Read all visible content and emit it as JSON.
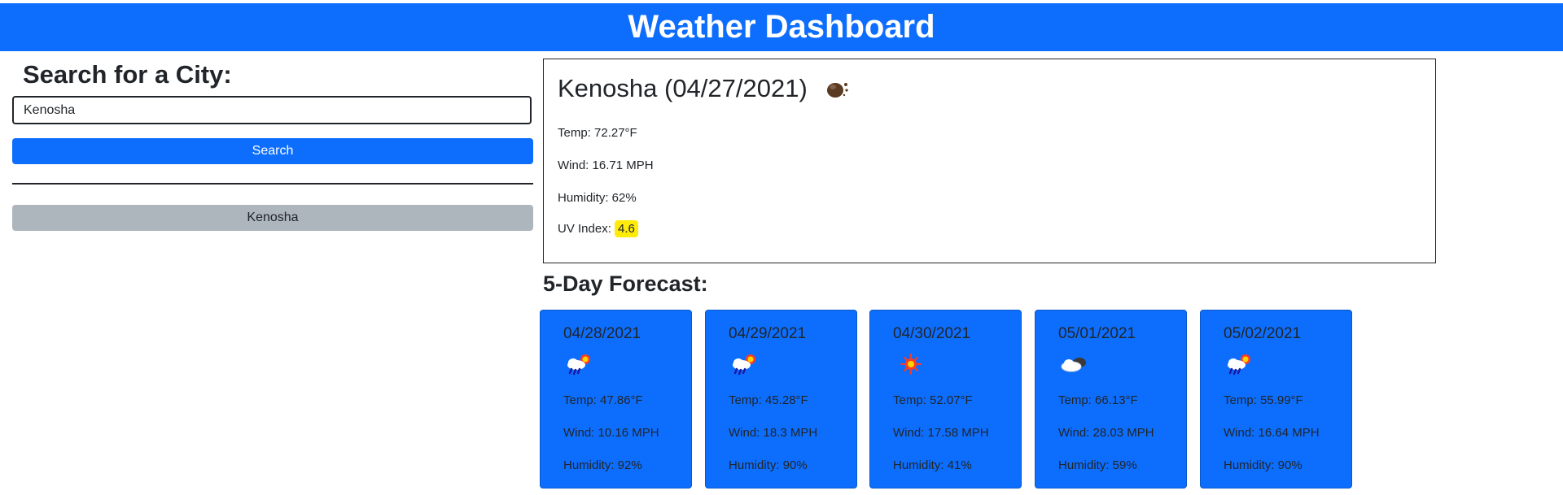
{
  "header": {
    "title": "Weather Dashboard"
  },
  "search": {
    "heading": "Search for a City:",
    "input_value": "Kenosha",
    "button_label": "Search",
    "history": [
      "Kenosha"
    ]
  },
  "current": {
    "title": "Kenosha (04/27/2021)",
    "icon": "rain-night-icon",
    "temp": "Temp: 72.27°F",
    "wind": "Wind: 16.71 MPH",
    "humidity": "Humidity: 62%",
    "uv_label": "UV Index:",
    "uv_value": "4.6",
    "uv_color": "#ffeb0a"
  },
  "forecast": {
    "heading": "5-Day Forecast:",
    "days": [
      {
        "date": "04/28/2021",
        "icon": "sun-rain-cloud-icon",
        "temp": "Temp: 47.86°F",
        "wind": "Wind: 10.16 MPH",
        "humidity": "Humidity: 92%"
      },
      {
        "date": "04/29/2021",
        "icon": "sun-rain-cloud-icon",
        "temp": "Temp: 45.28°F",
        "wind": "Wind: 18.3 MPH",
        "humidity": "Humidity: 90%"
      },
      {
        "date": "04/30/2021",
        "icon": "sun-icon",
        "temp": "Temp: 52.07°F",
        "wind": "Wind: 17.58 MPH",
        "humidity": "Humidity: 41%"
      },
      {
        "date": "05/01/2021",
        "icon": "cloudy-icon",
        "temp": "Temp: 66.13°F",
        "wind": "Wind: 28.03 MPH",
        "humidity": "Humidity: 59%"
      },
      {
        "date": "05/02/2021",
        "icon": "sun-rain-cloud-icon",
        "temp": "Temp: 55.99°F",
        "wind": "Wind: 16.64 MPH",
        "humidity": "Humidity: 90%"
      }
    ]
  },
  "colors": {
    "primary": "#0d6efd",
    "history_button": "#adb5bd",
    "uv_moderate": "#ffeb0a"
  }
}
